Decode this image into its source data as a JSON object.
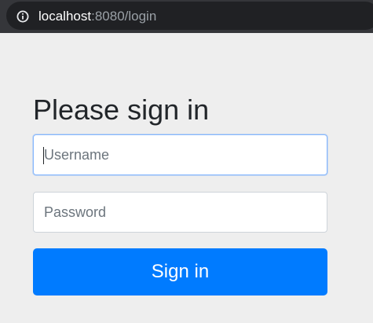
{
  "browser": {
    "url_host": "localhost",
    "url_rest": ":8080/login",
    "info_icon": "info-circle-icon"
  },
  "form": {
    "heading": "Please sign in",
    "username_placeholder": "Username",
    "password_placeholder": "Password",
    "submit_label": "Sign in"
  },
  "colors": {
    "address_bar": "#35363a",
    "url_field": "#202124",
    "page_background": "#eeeeee",
    "button_primary": "#007bff",
    "focus_border": "#86b7fe"
  }
}
